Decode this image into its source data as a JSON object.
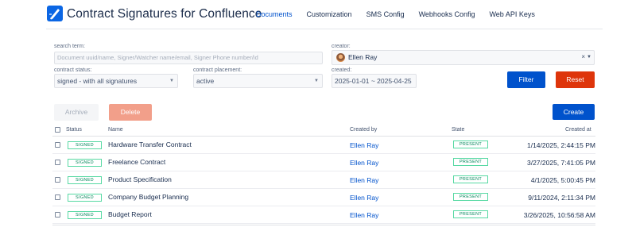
{
  "app": {
    "title": "Contract Signatures for Confluence"
  },
  "tabs": [
    {
      "label": "Documents",
      "active": true
    },
    {
      "label": "Customization",
      "active": false
    },
    {
      "label": "SMS Config",
      "active": false
    },
    {
      "label": "Webhooks Config",
      "active": false
    },
    {
      "label": "Web API Keys",
      "active": false
    }
  ],
  "filters": {
    "search": {
      "label": "search term:",
      "placeholder": "Document uuid/name, Signer/Watcher name/email, Signer Phone number/id"
    },
    "creator": {
      "label": "creator:",
      "value": "Ellen Ray",
      "clear": "×"
    },
    "contract_status": {
      "label": "contract status:",
      "value": "signed - with all signatures"
    },
    "contract_placement": {
      "label": "contract placement:",
      "value": "active"
    },
    "created": {
      "label": "created:",
      "value": "2025-01-01 ~ 2025-04-25"
    },
    "filter_label": "Filter",
    "reset_label": "Reset"
  },
  "actions": {
    "archive_label": "Archive",
    "delete_label": "Delete",
    "create_label": "Create"
  },
  "table": {
    "headers": {
      "status": "Status",
      "name": "Name",
      "created_by": "Created by",
      "state": "State",
      "created_at": "Created at"
    },
    "rows": [
      {
        "status": "SIGNED",
        "name": "Hardware Transfer Contract",
        "created_by": "Ellen Ray",
        "state": "PRESENT",
        "created_at": "1/14/2025, 2:44:15 PM"
      },
      {
        "status": "SIGNED",
        "name": "Freelance Contract",
        "created_by": "Ellen Ray",
        "state": "PRESENT",
        "created_at": "3/27/2025, 7:41:05 PM"
      },
      {
        "status": "SIGNED",
        "name": "Product Specification",
        "created_by": "Ellen Ray",
        "state": "PRESENT",
        "created_at": "4/1/2025, 5:00:45 PM"
      },
      {
        "status": "SIGNED",
        "name": "Company Budget Planning",
        "created_by": "Ellen Ray",
        "state": "PRESENT",
        "created_at": "9/11/2024, 2:11:34 PM"
      },
      {
        "status": "SIGNED",
        "name": "Budget Report",
        "created_by": "Ellen Ray",
        "state": "PRESENT",
        "created_at": "3/26/2025, 10:56:58 AM"
      }
    ]
  },
  "colors": {
    "primary": "#0052cc",
    "danger": "#de350b",
    "success": "#00875a"
  },
  "icons": {
    "logo": "pen-signature-icon",
    "caret": "chevron-down-icon"
  }
}
